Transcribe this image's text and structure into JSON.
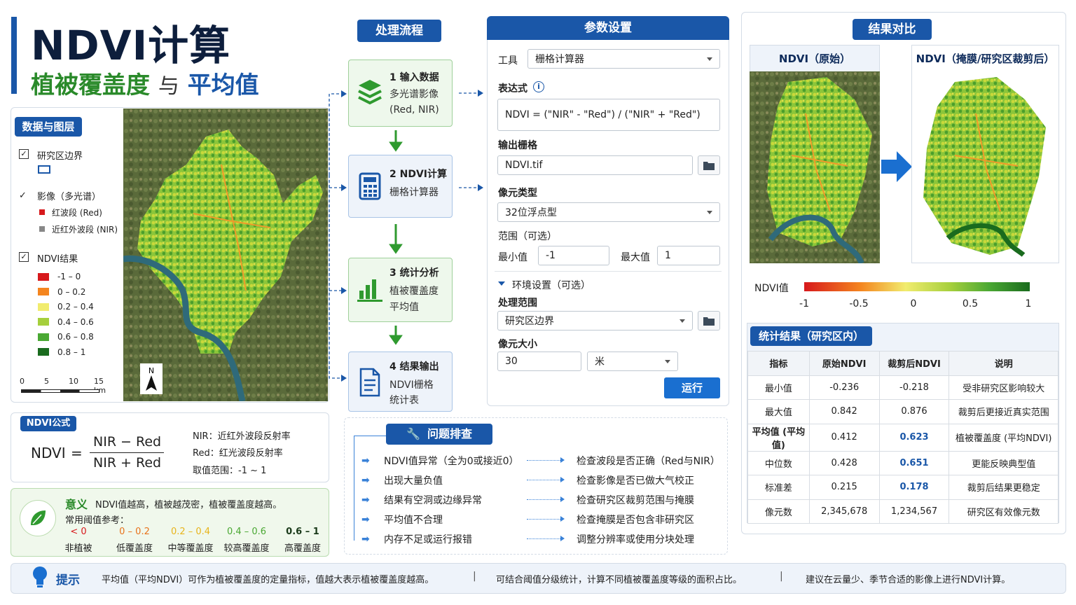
{
  "header": {
    "title": "NDVI计算",
    "subtitle_a": "植被覆盖度",
    "subtitle_mid": "与",
    "subtitle_b": "平均值"
  },
  "layers": {
    "tag": "数据与图层",
    "items": [
      {
        "label": "研究区边界"
      },
      {
        "label": "影像（多光谱）"
      },
      {
        "label": "红波段 (Red)"
      },
      {
        "label": "近红外波段 (NIR)"
      },
      {
        "label": "NDVI结果"
      }
    ],
    "legend": [
      "-1 – 0",
      "0 – 0.2",
      "0.2 – 0.4",
      "0.4 – 0.6",
      "0.6 – 0.8",
      "0.8 – 1"
    ],
    "legend_colors": [
      "#d7191c",
      "#f4851f",
      "#f1ec6e",
      "#a5cf3c",
      "#4aa833",
      "#1a6b1e"
    ],
    "scale": {
      "s0": "0",
      "s1": "5",
      "s2": "10",
      "s3": "15 km"
    },
    "north": "N"
  },
  "formula": {
    "tag": "NDVI公式",
    "lhs": "NDVI",
    "eq": "=",
    "num": "NIR − Red",
    "den": "NIR + Red",
    "nir": "NIR：近红外波段反射率",
    "red": "Red：红光波段反射率",
    "range": "取值范围：-1 ~ 1"
  },
  "meaning": {
    "title": "意义",
    "text": "NDVI值越高，植被越茂密，植被覆盖度越高。",
    "ref": "常用阈值参考：",
    "levels": [
      {
        "range": "< 0",
        "name": "非植被",
        "color": "#d7191c"
      },
      {
        "range": "0 – 0.2",
        "name": "低覆盖度",
        "color": "#e8731c"
      },
      {
        "range": "0.2 – 0.4",
        "name": "中等覆盖度",
        "color": "#e8b41c"
      },
      {
        "range": "0.4 – 0.6",
        "name": "较高覆盖度",
        "color": "#4aa833"
      },
      {
        "range": "0.6 – 1",
        "name": "高覆盖度",
        "color": "#1a3a1a"
      }
    ]
  },
  "flow": {
    "tag": "处理流程",
    "steps": [
      {
        "num": "1  输入数据",
        "sub1": "多光谱影像",
        "sub2": "(Red, NIR)"
      },
      {
        "num": "2  NDVI计算",
        "sub1": "栅格计算器",
        "sub2": ""
      },
      {
        "num": "3  统计分析",
        "sub1": "植被覆盖度",
        "sub2": "平均值"
      },
      {
        "num": "4  结果输出",
        "sub1": "NDVI栅格",
        "sub2": "统计表"
      }
    ]
  },
  "params": {
    "tag": "参数设置",
    "tool_label": "工具",
    "tool_value": "栅格计算器",
    "expr_label": "表达式",
    "expr_value": "NDVI = (\"NIR\" - \"Red\") / (\"NIR\" + \"Red\")",
    "out_label": "输出栅格",
    "out_value": "NDVI.tif",
    "pix_label": "像元类型",
    "pix_value": "32位浮点型",
    "range_label": "范围（可选）",
    "min_label": "最小值",
    "min_value": "-1",
    "max_label": "最大值",
    "max_value": "1",
    "env_label": "环境设置（可选）",
    "proc_label": "处理范围",
    "proc_value": "研究区边界",
    "cell_label": "像元大小",
    "cell_value": "30",
    "unit_value": "米",
    "run": "运行"
  },
  "trouble": {
    "tag": "问题排查",
    "rows": [
      {
        "issue": "NDVI值异常（全为0或接近0）",
        "fix": "检查波段是否正确（Red与NIR）"
      },
      {
        "issue": "出现大量负值",
        "fix": "检查影像是否已做大气校正"
      },
      {
        "issue": "结果有空洞或边缘异常",
        "fix": "检查研究区裁剪范围与掩膜"
      },
      {
        "issue": "平均值不合理",
        "fix": "检查掩膜是否包含非研究区"
      },
      {
        "issue": "内存不足或运行报错",
        "fix": "调整分辨率或使用分块处理"
      }
    ]
  },
  "compare": {
    "tag": "结果对比",
    "left": "NDVI（原始）",
    "right": "NDVI（掩膜/研究区裁剪后）",
    "bar_label": "NDVI值",
    "ticks": [
      "-1",
      "-0.5",
      "0",
      "0.5",
      "1"
    ]
  },
  "stats": {
    "tag": "统计结果（研究区内）",
    "headers": [
      "指标",
      "原始NDVI",
      "裁剪后NDVI",
      "说明"
    ],
    "rows": [
      [
        "最小值",
        "-0.236",
        "-0.218",
        "受非研究区影响较大"
      ],
      [
        "最大值",
        "0.842",
        "0.876",
        "裁剪后更接近真实范围"
      ],
      [
        "平均值 (平均值)",
        "0.412",
        "0.623",
        "植被覆盖度 (平均NDVI)"
      ],
      [
        "中位数",
        "0.428",
        "0.651",
        "更能反映典型值"
      ],
      [
        "标准差",
        "0.215",
        "0.178",
        "裁剪后结果更稳定"
      ],
      [
        "像元数",
        "2,345,678",
        "1,234,567",
        "研究区有效像元数"
      ]
    ]
  },
  "tip": {
    "label": "提示",
    "t1": "平均值（平均NDVI）可作为植被覆盖度的定量指标，值越大表示植被覆盖度越高。",
    "sep": "|",
    "t2": "可结合阈值分级统计，计算不同植被覆盖度等级的面积占比。",
    "t3": "建议在云量少、季节合适的影像上进行NDVI计算。"
  }
}
